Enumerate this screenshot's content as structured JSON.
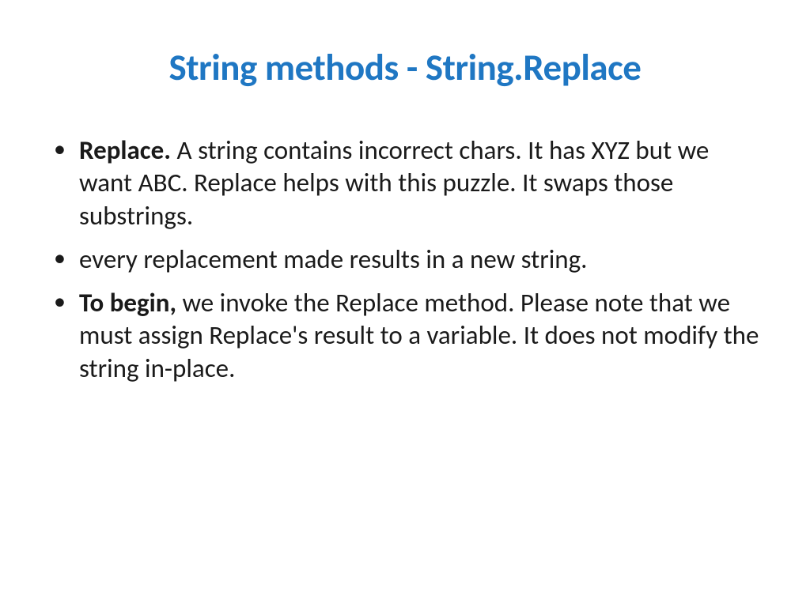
{
  "title": "String methods - String.Replace",
  "bullets": [
    {
      "lead_bold": "Replace.",
      "rest": " A string contains incorrect chars. It has XYZ but we want ABC. Replace helps with this puzzle. It swaps those substrings."
    },
    {
      "lead_bold": "",
      "rest": "every replacement made results in a new string."
    },
    {
      "lead_bold": "To begin,",
      "rest": " we invoke the Replace method. Please note that we must assign Replace's result to a variable. It does not modify the string in-place."
    }
  ]
}
